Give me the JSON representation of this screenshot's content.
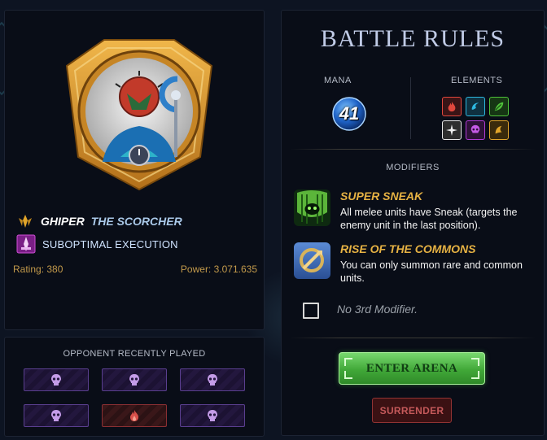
{
  "summoner": {
    "name_first": "GHIPER",
    "name_title": "THE SCORCHER",
    "ability": "SUBOPTIMAL EXECUTION",
    "rating": "Rating: 380",
    "power": "Power: 3.071.635"
  },
  "opponent": {
    "title": "OPPONENT RECENTLY PLAYED",
    "cards": [
      {
        "icon": "death-skull-icon"
      },
      {
        "icon": "death-skull-icon"
      },
      {
        "icon": "death-skull-icon"
      },
      {
        "icon": "death-skull-icon"
      },
      {
        "icon": "fire-icon"
      },
      {
        "icon": "death-skull-icon"
      }
    ]
  },
  "battle_rules": {
    "title": "BATTLE RULES",
    "mana_label": "MANA",
    "mana_value": "41",
    "elements_label": "ELEMENTS",
    "elements": [
      {
        "name": "fire-icon",
        "color": "#e0473d"
      },
      {
        "name": "water-icon",
        "color": "#2db8e0"
      },
      {
        "name": "earth-icon",
        "color": "#4fc23a"
      },
      {
        "name": "life-icon",
        "color": "#e8e8e8"
      },
      {
        "name": "death-icon",
        "color": "#b23bd8"
      },
      {
        "name": "dragon-icon",
        "color": "#e2a52a"
      }
    ],
    "modifiers_label": "MODIFIERS",
    "modifiers": [
      {
        "name": "SUPER SNEAK",
        "description": "All melee units have Sneak (targets the enemy unit in the last position).",
        "icon": "super-sneak-icon"
      },
      {
        "name": "RISE OF THE COMMONS",
        "description": "You can only summon rare and common units.",
        "icon": "rise-of-commons-icon"
      }
    ],
    "no_modifier": "No 3rd Modifier.",
    "enter_label": "ENTER ARENA",
    "surrender_label": "SURRENDER"
  },
  "colors": {
    "accent_gold": "#e6b243",
    "enter_green": "#41a838",
    "surrender_red": "#913333",
    "mana_blue": "#1f63c8"
  }
}
